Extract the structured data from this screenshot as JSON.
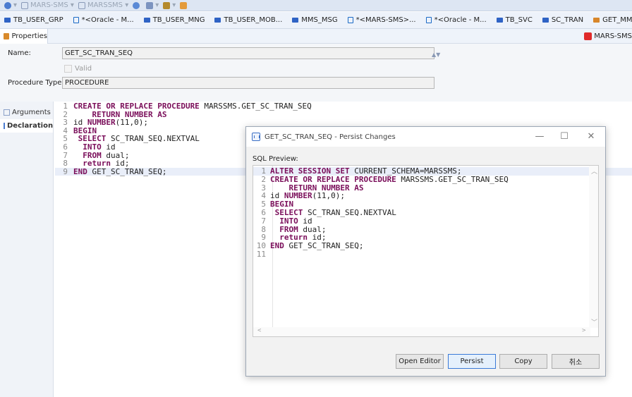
{
  "toolbar": {
    "items": [
      "MARS-SMS",
      "MARSSMS"
    ]
  },
  "tabs": [
    {
      "label": "TB_USER_GRP",
      "icon": "table-icon"
    },
    {
      "label": "*<Oracle - M...",
      "icon": "sql-editor-icon"
    },
    {
      "label": "TB_USER_MNG",
      "icon": "table-icon"
    },
    {
      "label": "TB_USER_MOB...",
      "icon": "table-icon"
    },
    {
      "label": "MMS_MSG",
      "icon": "table-icon"
    },
    {
      "label": "*<MARS-SMS>...",
      "icon": "sql-editor-icon"
    },
    {
      "label": "*<Oracle - M...",
      "icon": "sql-editor-icon"
    },
    {
      "label": "TB_SVC",
      "icon": "table-icon"
    },
    {
      "label": "SC_TRAN",
      "icon": "table-icon"
    },
    {
      "label": "GET_MMS_M",
      "icon": "procedure-icon"
    }
  ],
  "properties": {
    "tab_label": "Properties",
    "connection": "MARS-SMS",
    "name_label": "Name:",
    "name_value": "GET_SC_TRAN_SEQ",
    "valid_label": "Valid",
    "type_label": "Procedure Type:",
    "type_value": "PROCEDURE"
  },
  "side_tabs": {
    "arguments": "Arguments",
    "declaration": "Declaration"
  },
  "source": {
    "line_numbers": [
      "1",
      "2",
      "3",
      "4",
      "5",
      "6",
      "7",
      "8",
      "9"
    ],
    "lines": [
      [
        {
          "t": "CREATE OR REPLACE PROCEDURE",
          "k": true
        },
        {
          "t": " MARSSMS.GET_SC_TRAN_SEQ",
          "k": false
        }
      ],
      [
        {
          "t": "    RETURN NUMBER AS",
          "k": true
        }
      ],
      [
        {
          "t": "id ",
          "k": false
        },
        {
          "t": "NUMBER",
          "k": true
        },
        {
          "t": "(11,0);",
          "k": false
        }
      ],
      [
        {
          "t": "BEGIN",
          "k": true
        }
      ],
      [
        {
          "t": " SELECT",
          "k": true
        },
        {
          "t": " SC_TRAN_SEQ.NEXTVAL",
          "k": false
        }
      ],
      [
        {
          "t": "  INTO",
          "k": true
        },
        {
          "t": " id",
          "k": false
        }
      ],
      [
        {
          "t": "  FROM",
          "k": true
        },
        {
          "t": " dual;",
          "k": false
        }
      ],
      [
        {
          "t": "  return",
          "k": true
        },
        {
          "t": " id;",
          "k": false
        }
      ],
      [
        {
          "t": "END",
          "k": true
        },
        {
          "t": " GET_SC_TRAN_SEQ;",
          "k": false
        }
      ]
    ]
  },
  "dialog": {
    "title": "GET_SC_TRAN_SEQ - Persist Changes",
    "preview_label": "SQL Preview:",
    "minimize": "—",
    "maximize": "☐",
    "close": "✕",
    "line_numbers": [
      "1",
      "2",
      "3",
      "4",
      "5",
      "6",
      "7",
      "8",
      "9",
      "10",
      "11"
    ],
    "lines": [
      [
        {
          "t": "ALTER SESSION SET",
          "k": true
        },
        {
          "t": " CURRENT_SCHEMA=MARSSMS;",
          "k": false
        }
      ],
      [
        {
          "t": "CREATE OR REPLACE PROCEDURE",
          "k": true
        },
        {
          "t": " MARSSMS.GET_SC_TRAN_SEQ",
          "k": false
        }
      ],
      [
        {
          "t": "    RETURN NUMBER AS",
          "k": true
        }
      ],
      [
        {
          "t": "id ",
          "k": false
        },
        {
          "t": "NUMBER",
          "k": true
        },
        {
          "t": "(11,0);",
          "k": false
        }
      ],
      [
        {
          "t": "BEGIN",
          "k": true
        }
      ],
      [
        {
          "t": " SELECT",
          "k": true
        },
        {
          "t": " SC_TRAN_SEQ.NEXTVAL",
          "k": false
        }
      ],
      [
        {
          "t": "  INTO",
          "k": true
        },
        {
          "t": " id",
          "k": false
        }
      ],
      [
        {
          "t": "  FROM",
          "k": true
        },
        {
          "t": " dual;",
          "k": false
        }
      ],
      [
        {
          "t": "  return",
          "k": true
        },
        {
          "t": " id;",
          "k": false
        }
      ],
      [
        {
          "t": "END",
          "k": true
        },
        {
          "t": " GET_SC_TRAN_SEQ;",
          "k": false
        }
      ],
      []
    ],
    "buttons": {
      "open_editor": "Open Editor",
      "persist": "Persist",
      "copy": "Copy",
      "cancel": "취소"
    }
  },
  "colors": {
    "keyword": "#7a0e5a",
    "accent": "#3a7ad8",
    "connection_red": "#e02a2a"
  }
}
